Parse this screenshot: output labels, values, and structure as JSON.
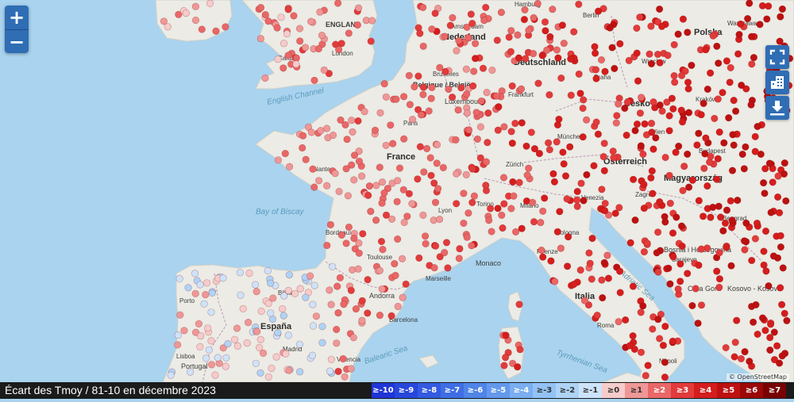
{
  "map": {
    "water_color": "#a9d3ee",
    "land_color": "#ecebe5",
    "countries": [
      {
        "label": "Deutschland"
      },
      {
        "label": "France"
      },
      {
        "label": "España"
      },
      {
        "label": "Italia"
      },
      {
        "label": "Polska"
      },
      {
        "label": "Česko"
      },
      {
        "label": "Österreich"
      },
      {
        "label": "Magyarország"
      },
      {
        "label": "Nederland"
      },
      {
        "label": "Belgique / België"
      },
      {
        "label": "Luxembourg"
      },
      {
        "label": "Andorra"
      },
      {
        "label": "Monaco"
      },
      {
        "label": "Bosnia i Hercegovina"
      },
      {
        "label": "Crna Gora"
      },
      {
        "label": "Kosovo - Kosova"
      },
      {
        "label": "Portugal"
      },
      {
        "label": "ENGLAND"
      }
    ],
    "seas": [
      {
        "label": "English Channel"
      },
      {
        "label": "Bay of Biscay"
      },
      {
        "label": "Balearic Sea"
      },
      {
        "label": "Tyrrhenian Sea"
      },
      {
        "label": "Adriatic Sea"
      }
    ],
    "cities": [
      {
        "label": "Berlin"
      },
      {
        "label": "Warszawa"
      },
      {
        "label": "Praha"
      },
      {
        "label": "Wien"
      },
      {
        "label": "Budapest"
      },
      {
        "label": "Paris"
      },
      {
        "label": "London"
      },
      {
        "label": "Bruxelles"
      },
      {
        "label": "Amsterdam"
      },
      {
        "label": "Frankfurt"
      },
      {
        "label": "Zürich"
      },
      {
        "label": "Milano"
      },
      {
        "label": "Lyon"
      },
      {
        "label": "Marseille"
      },
      {
        "label": "Barcelona"
      },
      {
        "label": "Madrid"
      },
      {
        "label": "Roma"
      },
      {
        "label": "Zagreb"
      },
      {
        "label": "Beograd"
      },
      {
        "label": "Bordeaux"
      },
      {
        "label": "Nantes"
      },
      {
        "label": "Toulouse"
      },
      {
        "label": "München"
      },
      {
        "label": "Hamburg"
      },
      {
        "label": "Kraków"
      },
      {
        "label": "Wrocław"
      },
      {
        "label": "Sarajevo"
      },
      {
        "label": "Cardiff"
      },
      {
        "label": "Torino"
      },
      {
        "label": "Venezia"
      },
      {
        "label": "Bologna"
      },
      {
        "label": "Firenze"
      },
      {
        "label": "Napoli"
      },
      {
        "label": "Valencia"
      },
      {
        "label": "Bilbao"
      },
      {
        "label": "Porto"
      },
      {
        "label": "Lisboa"
      }
    ]
  },
  "controls": {
    "zoom_in": "+",
    "zoom_out": "−",
    "tools": [
      {
        "icon": "fullscreen-icon"
      },
      {
        "icon": "city-icon"
      },
      {
        "icon": "download-icon"
      }
    ]
  },
  "footer": {
    "caption": "Écart des Tmoy / 81-10 en décembre 2023",
    "scale": [
      {
        "label": "≥-10",
        "color": "#1f35d6"
      },
      {
        "label": "≥-9",
        "color": "#2747dc"
      },
      {
        "label": "≥-8",
        "color": "#335ae0"
      },
      {
        "label": "≥-7",
        "color": "#3f6ee4"
      },
      {
        "label": "≥-6",
        "color": "#4f84e8"
      },
      {
        "label": "≥-5",
        "color": "#6399ec"
      },
      {
        "label": "≥-4",
        "color": "#7aaef0"
      },
      {
        "label": "≥-3",
        "color": "#93c2f4"
      },
      {
        "label": "≥-2",
        "color": "#aed3f7"
      },
      {
        "label": "≥-1",
        "color": "#cde3fa"
      },
      {
        "label": "≥0",
        "color": "#f6cbcb"
      },
      {
        "label": "≥1",
        "color": "#ef9797"
      },
      {
        "label": "≥2",
        "color": "#e96767"
      },
      {
        "label": "≥3",
        "color": "#e23b3b"
      },
      {
        "label": "≥4",
        "color": "#d51d1d"
      },
      {
        "label": "≥5",
        "color": "#bd1111"
      },
      {
        "label": "≥6",
        "color": "#9b0808"
      },
      {
        "label": "≥7",
        "color": "#780202"
      }
    ]
  }
}
